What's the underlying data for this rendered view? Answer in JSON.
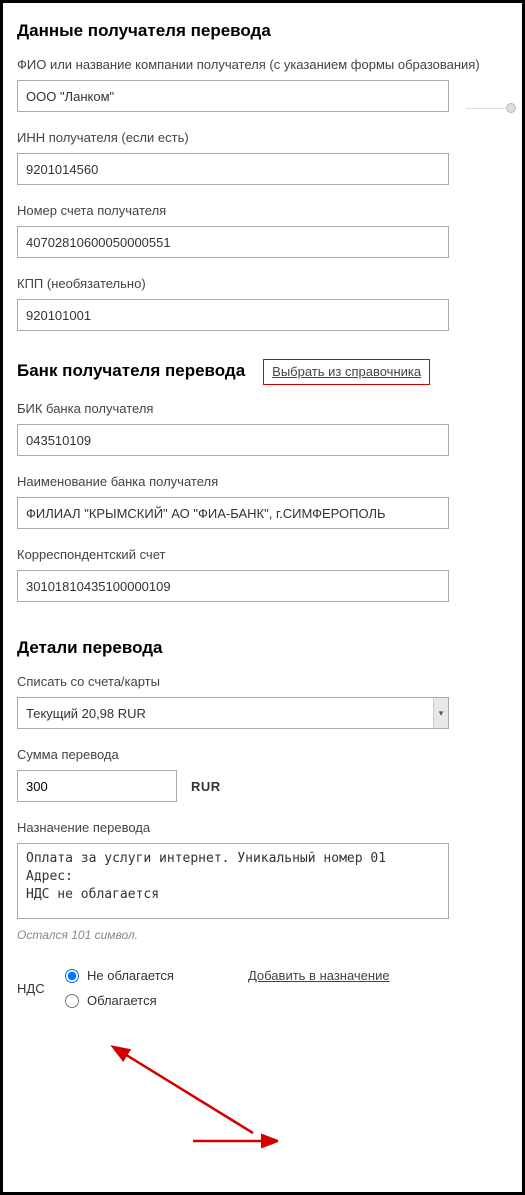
{
  "recipient": {
    "heading": "Данные получателя перевода",
    "name_label": "ФИО или название компании получателя (с указанием формы образования)",
    "name_value": "ООО \"Ланком\"",
    "inn_label": "ИНН получателя (если есть)",
    "inn_value": "9201014560",
    "account_label": "Номер счета получателя",
    "account_value": "40702810600050000551",
    "kpp_label": "КПП (необязательно)",
    "kpp_value": "920101001"
  },
  "bank": {
    "heading": "Банк получателя перевода",
    "directory_link": "Выбрать из справочника",
    "bik_label": "БИК банка получателя",
    "bik_value": "043510109",
    "name_label": "Наименование банка получателя",
    "name_value": "ФИЛИАЛ \"КРЫМСКИЙ\" АО \"ФИА-БАНК\", г.СИМФЕРОПОЛЬ",
    "corr_label": "Корреспондентский счет",
    "corr_value": "30101810435100000109"
  },
  "details": {
    "heading": "Детали перевода",
    "from_label": "Списать со счета/карты",
    "from_value": "Текущий 20,98 RUR",
    "amount_label": "Сумма перевода",
    "amount_value": "300",
    "currency": "RUR",
    "purpose_label": "Назначение перевода",
    "purpose_value": "Оплата за услуги интернет. Уникальный номер 01\nАдрес:\nНДС не облагается",
    "counter": "Остался 101 символ."
  },
  "nds": {
    "label": "НДС",
    "opt1": "Не облагается",
    "opt2": "Облагается",
    "add_link": "Добавить в назначение"
  }
}
